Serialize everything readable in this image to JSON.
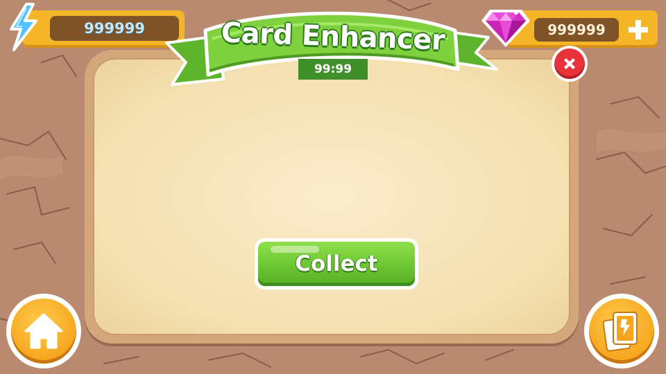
{
  "hud": {
    "energy_value": "999999",
    "gem_value": "999999"
  },
  "panel": {
    "title": "Card Enhancer",
    "timer": "99:99"
  },
  "actions": {
    "collect_label": "Collect"
  },
  "icons": {
    "energy": "lightning-bolt-icon",
    "gem": "pink-diamond-icon",
    "add": "plus-icon",
    "close": "close-x-icon",
    "home": "home-icon",
    "cards": "card-deck-icon"
  },
  "colors": {
    "background": "#b98a6f",
    "panel_parchment": "#f4e0b0",
    "ribbon_green": "#6cc632",
    "collect_green": "#6cc632",
    "hud_orange": "#f5b529",
    "close_red": "#e8323a",
    "gem_pink": "#e84bd8"
  }
}
